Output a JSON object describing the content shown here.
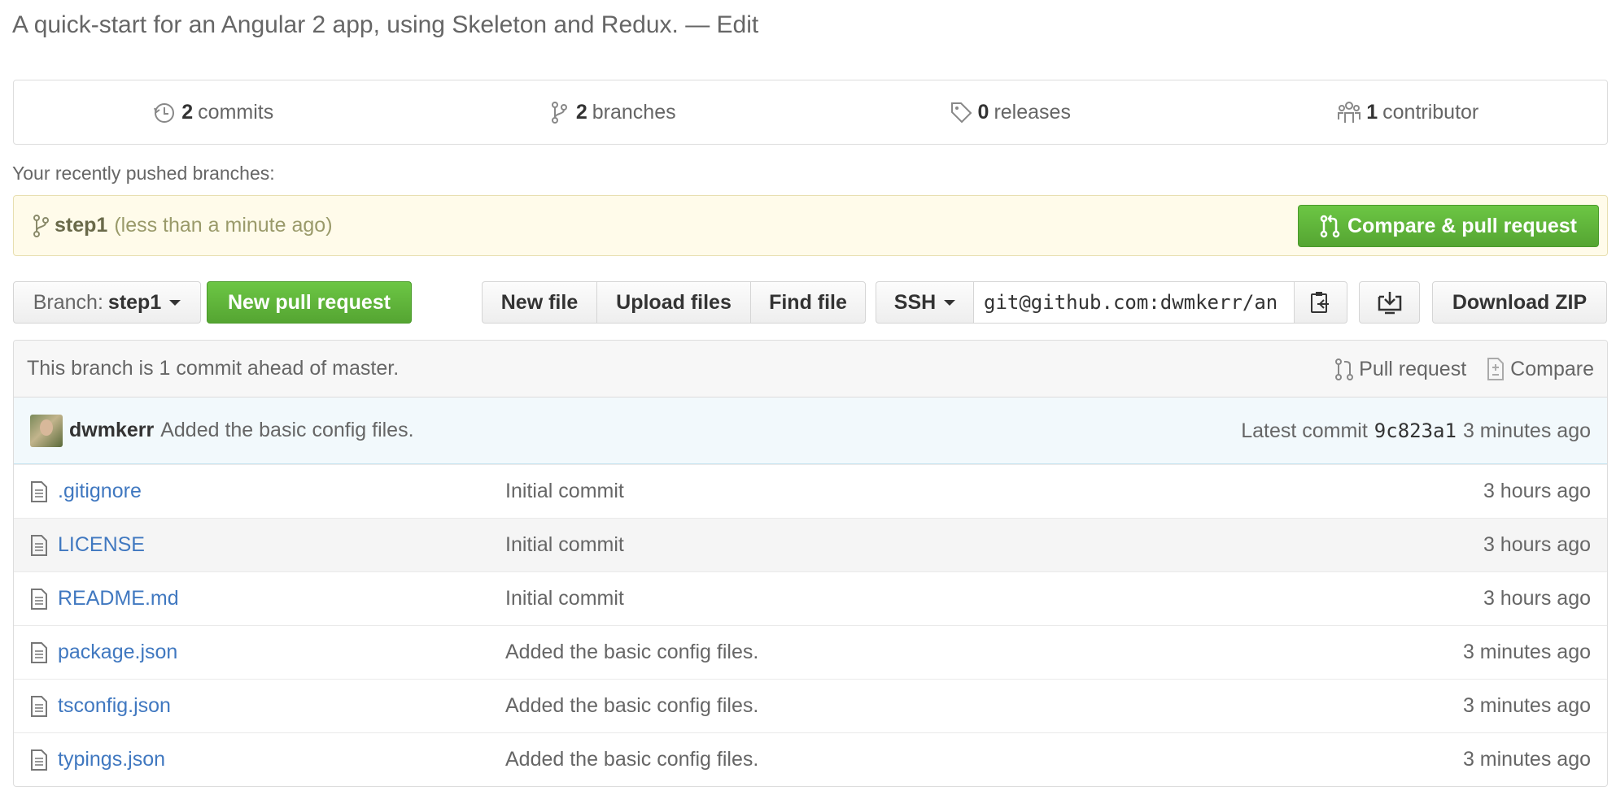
{
  "description": {
    "text": "A quick-start for an Angular 2 app, using Skeleton and Redux.",
    "separator": "—",
    "edit": "Edit"
  },
  "summary": [
    {
      "icon": "history-icon",
      "count": "2",
      "label": "commits"
    },
    {
      "icon": "branch-icon",
      "count": "2",
      "label": "branches"
    },
    {
      "icon": "tag-icon",
      "count": "0",
      "label": "releases"
    },
    {
      "icon": "organization-icon",
      "count": "1",
      "label": "contributor"
    }
  ],
  "recent": {
    "label": "Your recently pushed branches:",
    "branch": "step1",
    "time": "(less than a minute ago)",
    "compare_button": "Compare & pull request"
  },
  "toolbar": {
    "branch_prefix": "Branch:",
    "branch_name": "step1",
    "new_pull_request": "New pull request",
    "new_file": "New file",
    "upload_files": "Upload files",
    "find_file": "Find file",
    "protocol": "SSH",
    "clone_url": "git@github.com:dwmkerr/an",
    "download_zip": "Download ZIP"
  },
  "status": {
    "text": "This branch is 1 commit ahead of master.",
    "pull_request": "Pull request",
    "compare": "Compare"
  },
  "latest_commit": {
    "author": "dwmkerr",
    "message": "Added the basic config files.",
    "label": "Latest commit",
    "sha": "9c823a1",
    "age": "3 minutes ago"
  },
  "files": [
    {
      "name": ".gitignore",
      "message": "Initial commit",
      "age": "3 hours ago"
    },
    {
      "name": "LICENSE",
      "message": "Initial commit",
      "age": "3 hours ago"
    },
    {
      "name": "README.md",
      "message": "Initial commit",
      "age": "3 hours ago"
    },
    {
      "name": "package.json",
      "message": "Added the basic config files.",
      "age": "3 minutes ago"
    },
    {
      "name": "tsconfig.json",
      "message": "Added the basic config files.",
      "age": "3 minutes ago"
    },
    {
      "name": "typings.json",
      "message": "Added the basic config files.",
      "age": "3 minutes ago"
    }
  ],
  "colors": {
    "link": "#4078c0",
    "green": "#6cc644",
    "recent_bg": "#fffbea",
    "commit_bg": "#f2f9fc"
  }
}
